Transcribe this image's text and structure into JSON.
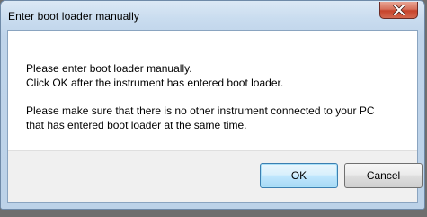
{
  "window": {
    "title": "Enter boot loader manually"
  },
  "message": {
    "line1": "Please enter boot loader manually.",
    "line2": "Click OK after the instrument has entered boot loader.",
    "line3": "Please make sure that there is no other instrument connected to your PC",
    "line4": "that has entered boot loader at the same time."
  },
  "buttons": {
    "ok_label": "OK",
    "cancel_label": "Cancel"
  },
  "icons": {
    "close": "close-icon"
  },
  "colors": {
    "close_button": "#c7432b",
    "default_button_border": "#3c7fb1"
  }
}
